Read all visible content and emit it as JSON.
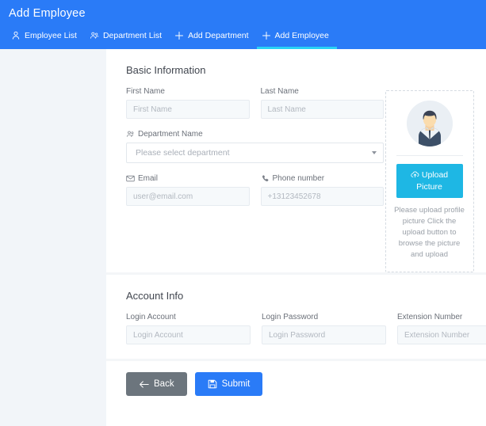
{
  "header": {
    "title": "Add Employee",
    "bg_color": "#2a7bf7",
    "active_underline_color": "#29d2f5",
    "tabs": [
      {
        "label": "Employee List",
        "icon": "user-icon",
        "active": false
      },
      {
        "label": "Department List",
        "icon": "users-icon",
        "active": false
      },
      {
        "label": "Add Department",
        "icon": "plus-icon",
        "active": false
      },
      {
        "label": "Add Employee",
        "icon": "plus-icon",
        "active": true
      }
    ]
  },
  "basic_information": {
    "title": "Basic Information",
    "first_name": {
      "label": "First Name",
      "placeholder": "First Name",
      "value": ""
    },
    "last_name": {
      "label": "Last Name",
      "placeholder": "Last Name",
      "value": ""
    },
    "department": {
      "label": "Department Name",
      "icon": "users-icon",
      "selected": "Please select department"
    },
    "email": {
      "label": "Email",
      "icon": "envelope-icon",
      "placeholder": "user@email.com",
      "value": ""
    },
    "phone": {
      "label": "Phone number",
      "icon": "phone-icon",
      "placeholder": "+13123452678",
      "value": ""
    }
  },
  "upload_panel": {
    "avatar": "default-profile-avatar",
    "button_label": "Upload Picture",
    "button_icon": "cloud-upload-icon",
    "button_color": "#1eb7e4",
    "hint": "Please upload profile picture Click the upload button to browse the picture and upload"
  },
  "account_info": {
    "title": "Account Info",
    "login_account": {
      "label": "Login Account",
      "placeholder": "Login Account",
      "value": ""
    },
    "login_password": {
      "label": "Login Password",
      "placeholder": "Login Password",
      "value": ""
    },
    "extension_number": {
      "label": "Extension Number",
      "placeholder": "Extension Number",
      "value": ""
    }
  },
  "footer": {
    "back_label": "Back",
    "back_icon": "arrow-left-icon",
    "back_color": "#6c757d",
    "submit_label": "Submit",
    "submit_icon": "save-icon",
    "submit_color": "#2a7bf7"
  }
}
